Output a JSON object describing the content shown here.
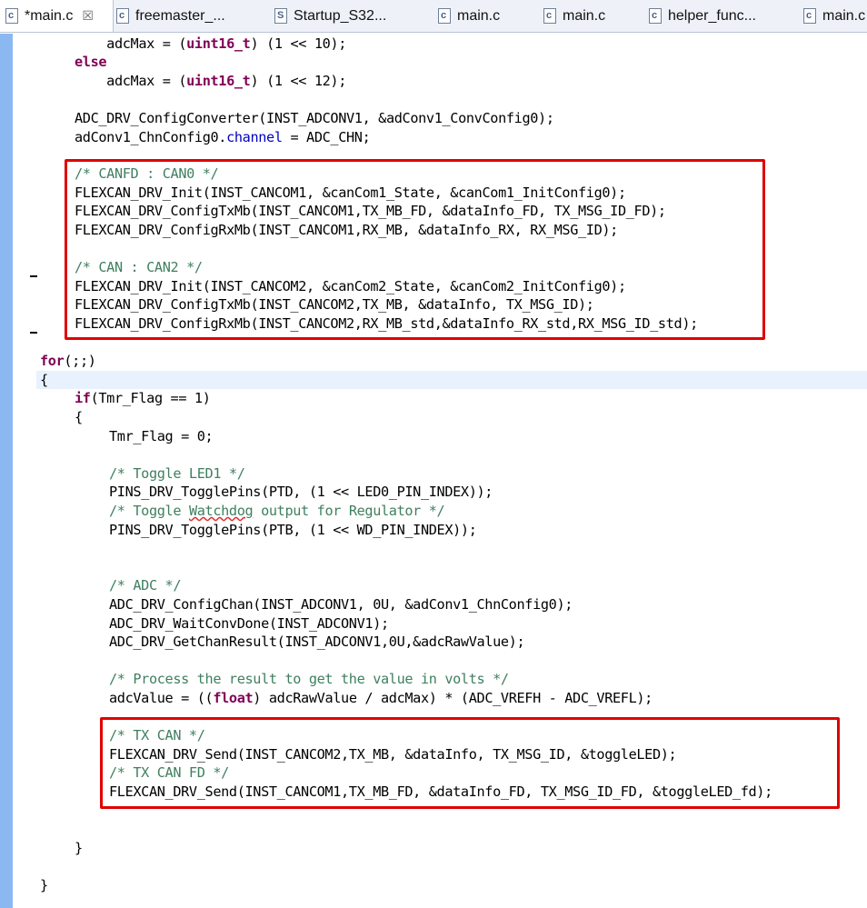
{
  "tabs": [
    {
      "label": "*main.c",
      "icon": "c-file-icon",
      "icon_glyph": "c",
      "active": true,
      "closable": true,
      "close_glyph": "☒"
    },
    {
      "label": "freemaster_...",
      "icon": "c-file-icon",
      "icon_glyph": "c"
    },
    {
      "label": "Startup_S32...",
      "icon": "s-file-icon",
      "icon_glyph": "S"
    },
    {
      "label": "main.c",
      "icon": "c-file-icon",
      "icon_glyph": "c"
    },
    {
      "label": "main.c",
      "icon": "c-file-icon",
      "icon_glyph": "c"
    },
    {
      "label": "helper_func...",
      "icon": "c-file-icon",
      "icon_glyph": "c"
    },
    {
      "label": "main.c",
      "icon": "c-file-icon",
      "icon_glyph": "c"
    }
  ],
  "code": {
    "l1_a": "    adcMax = (",
    "l1_kw": "uint16_t",
    "l1_b": ") (1 << 10);",
    "l2_kw": "else",
    "l3_a": "    adcMax = (",
    "l3_kw": "uint16_t",
    "l3_b": ") (1 << 12);",
    "l5": "ADC_DRV_ConfigConverter(INST_ADCONV1, &adConv1_ConvConfig0);",
    "l6_a": "adConv1_ChnConfig0.",
    "l6_fld": "channel",
    "l6_b": " = ADC_CHN;",
    "l8": "/* CANFD : CAN0 */",
    "l9": "FLEXCAN_DRV_Init(INST_CANCOM1, &canCom1_State, &canCom1_InitConfig0);",
    "l10": "FLEXCAN_DRV_ConfigTxMb(INST_CANCOM1,TX_MB_FD, &dataInfo_FD, TX_MSG_ID_FD);",
    "l11": "FLEXCAN_DRV_ConfigRxMb(INST_CANCOM1,RX_MB, &dataInfo_RX, RX_MSG_ID);",
    "l13": "/* CAN : CAN2 */",
    "l14": "FLEXCAN_DRV_Init(INST_CANCOM2, &canCom2_State, &canCom2_InitConfig0);",
    "l15": "FLEXCAN_DRV_ConfigTxMb(INST_CANCOM2,TX_MB, &dataInfo, TX_MSG_ID);",
    "l16": "FLEXCAN_DRV_ConfigRxMb(INST_CANCOM2,RX_MB_std,&dataInfo_RX_std,RX_MSG_ID_std);",
    "l18_kw": "for",
    "l18_b": "(;;)",
    "l19": "{",
    "l20_kw": "if",
    "l20_b": "(Tmr_Flag == 1)",
    "l21": "{",
    "l22": "Tmr_Flag = 0;",
    "l24": "/* Toggle LED1 */",
    "l25": "PINS_DRV_TogglePins(PTD, (1 << LED0_PIN_INDEX));",
    "l26_a": "/* Toggle ",
    "l26_sq": "Watchdog",
    "l26_b": " output for Regulator */",
    "l27": "PINS_DRV_TogglePins(PTB, (1 << WD_PIN_INDEX));",
    "l30": "/* ADC */",
    "l31": "ADC_DRV_ConfigChan(INST_ADCONV1, 0U, &adConv1_ChnConfig0);",
    "l32": "ADC_DRV_WaitConvDone(INST_ADCONV1);",
    "l33": "ADC_DRV_GetChanResult(INST_ADCONV1,0U,&adcRawValue);",
    "l35": "/* Process the result to get the value in volts */",
    "l36_a": "adcValue = ((",
    "l36_kw": "float",
    "l36_b": ") adcRawValue / adcMax) * (ADC_VREFH - ADC_VREFL);",
    "l38": "/* TX CAN */",
    "l39": "FLEXCAN_DRV_Send(INST_CANCOM2,TX_MB, &dataInfo, TX_MSG_ID, &toggleLED);",
    "l40": "/* TX CAN FD */",
    "l41": "FLEXCAN_DRV_Send(INST_CANCOM1,TX_MB_FD, &dataInfo_FD, TX_MSG_ID_FD, &toggleLED_fd);",
    "l44": "}",
    "l46": "}"
  },
  "colors": {
    "keyword": "#7f0055",
    "comment": "#3f7f5f",
    "field": "#0000c0",
    "highlight_box": "#e00000",
    "ruler": "#8cb8f2"
  }
}
